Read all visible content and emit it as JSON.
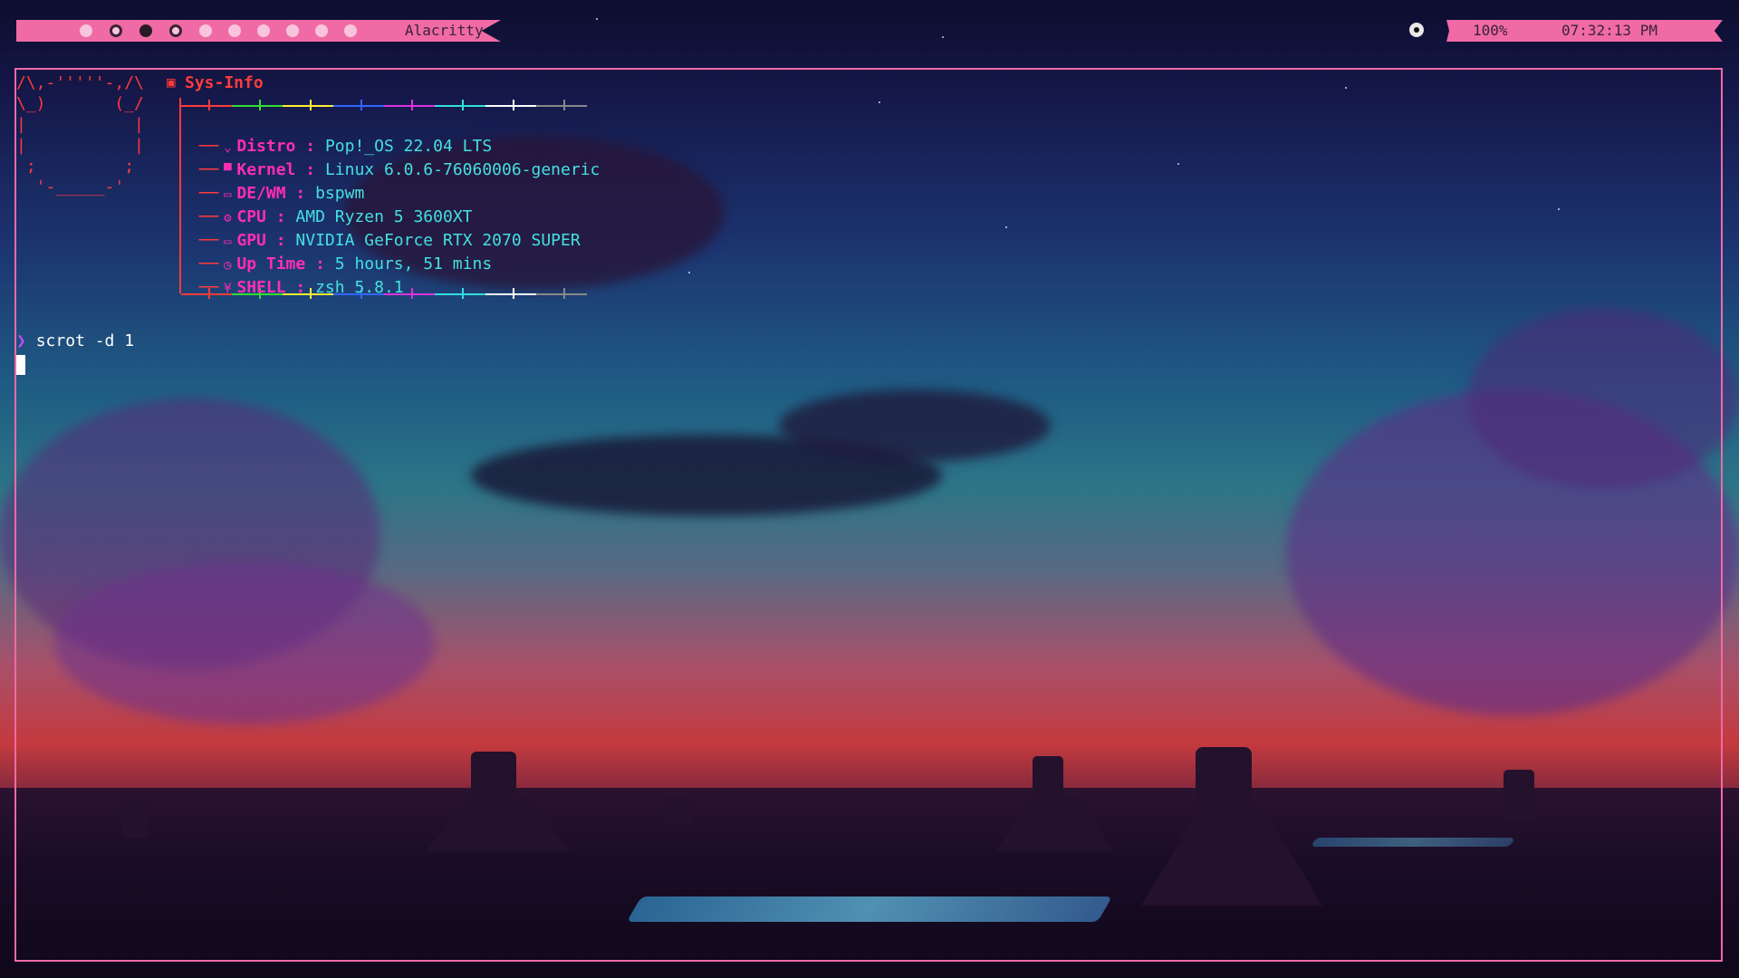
{
  "topbar": {
    "window_title": "Alacritty",
    "volume": "100%",
    "clock": "07:32:13 PM",
    "accent_color": "#f06aa6",
    "workspaces": [
      "empty",
      "occupied",
      "focused",
      "occupied",
      "empty",
      "empty",
      "empty",
      "empty",
      "empty",
      "empty"
    ]
  },
  "terminal": {
    "ascii_art": "/\\,-'''''-,/\\\n\\_)       (_/\n|           |\n|           |\n ;         ;\n  '-_____-'",
    "header": "Sys-Info",
    "rows": [
      {
        "icon": "pop-os-icon",
        "glyph": "⌄",
        "label": "Distro",
        "value": "Pop!_OS 22.04 LTS"
      },
      {
        "icon": "kernel-icon",
        "glyph": "▀",
        "label": "Kernel",
        "value": "Linux 6.0.6-76060006-generic"
      },
      {
        "icon": "window-icon",
        "glyph": "▭",
        "label": "DE/WM",
        "value": "bspwm"
      },
      {
        "icon": "cpu-icon",
        "glyph": "⚙",
        "label": "CPU",
        "value": "AMD Ryzen 5 3600XT"
      },
      {
        "icon": "monitor-icon",
        "glyph": "▭",
        "label": "GPU",
        "value": "NVIDIA GeForce RTX 2070 SUPER"
      },
      {
        "icon": "clock-icon",
        "glyph": "◷",
        "label": "Up Time",
        "value": "5 hours, 51 mins"
      },
      {
        "icon": "terminal-icon",
        "glyph": "¥",
        "label": "SHELL",
        "value": "zsh 5.8.1"
      }
    ],
    "separator": ":",
    "prompt_symbol": "❯",
    "command": "scrot -d 1"
  },
  "rule_colors": [
    "#ff3b3b",
    "#33dd33",
    "#ffee33",
    "#3366ff",
    "#dd33dd",
    "#33dddd",
    "#ffffff",
    "#888888"
  ]
}
